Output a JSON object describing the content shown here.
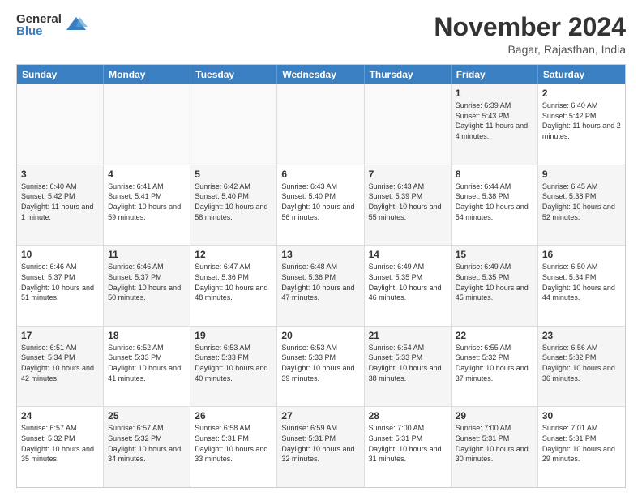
{
  "logo": {
    "general": "General",
    "blue": "Blue"
  },
  "header": {
    "month": "November 2024",
    "location": "Bagar, Rajasthan, India"
  },
  "weekdays": [
    "Sunday",
    "Monday",
    "Tuesday",
    "Wednesday",
    "Thursday",
    "Friday",
    "Saturday"
  ],
  "rows": [
    [
      {
        "day": "",
        "info": ""
      },
      {
        "day": "",
        "info": ""
      },
      {
        "day": "",
        "info": ""
      },
      {
        "day": "",
        "info": ""
      },
      {
        "day": "",
        "info": ""
      },
      {
        "day": "1",
        "info": "Sunrise: 6:39 AM\nSunset: 5:43 PM\nDaylight: 11 hours and 4 minutes."
      },
      {
        "day": "2",
        "info": "Sunrise: 6:40 AM\nSunset: 5:42 PM\nDaylight: 11 hours and 2 minutes."
      }
    ],
    [
      {
        "day": "3",
        "info": "Sunrise: 6:40 AM\nSunset: 5:42 PM\nDaylight: 11 hours and 1 minute."
      },
      {
        "day": "4",
        "info": "Sunrise: 6:41 AM\nSunset: 5:41 PM\nDaylight: 10 hours and 59 minutes."
      },
      {
        "day": "5",
        "info": "Sunrise: 6:42 AM\nSunset: 5:40 PM\nDaylight: 10 hours and 58 minutes."
      },
      {
        "day": "6",
        "info": "Sunrise: 6:43 AM\nSunset: 5:40 PM\nDaylight: 10 hours and 56 minutes."
      },
      {
        "day": "7",
        "info": "Sunrise: 6:43 AM\nSunset: 5:39 PM\nDaylight: 10 hours and 55 minutes."
      },
      {
        "day": "8",
        "info": "Sunrise: 6:44 AM\nSunset: 5:38 PM\nDaylight: 10 hours and 54 minutes."
      },
      {
        "day": "9",
        "info": "Sunrise: 6:45 AM\nSunset: 5:38 PM\nDaylight: 10 hours and 52 minutes."
      }
    ],
    [
      {
        "day": "10",
        "info": "Sunrise: 6:46 AM\nSunset: 5:37 PM\nDaylight: 10 hours and 51 minutes."
      },
      {
        "day": "11",
        "info": "Sunrise: 6:46 AM\nSunset: 5:37 PM\nDaylight: 10 hours and 50 minutes."
      },
      {
        "day": "12",
        "info": "Sunrise: 6:47 AM\nSunset: 5:36 PM\nDaylight: 10 hours and 48 minutes."
      },
      {
        "day": "13",
        "info": "Sunrise: 6:48 AM\nSunset: 5:36 PM\nDaylight: 10 hours and 47 minutes."
      },
      {
        "day": "14",
        "info": "Sunrise: 6:49 AM\nSunset: 5:35 PM\nDaylight: 10 hours and 46 minutes."
      },
      {
        "day": "15",
        "info": "Sunrise: 6:49 AM\nSunset: 5:35 PM\nDaylight: 10 hours and 45 minutes."
      },
      {
        "day": "16",
        "info": "Sunrise: 6:50 AM\nSunset: 5:34 PM\nDaylight: 10 hours and 44 minutes."
      }
    ],
    [
      {
        "day": "17",
        "info": "Sunrise: 6:51 AM\nSunset: 5:34 PM\nDaylight: 10 hours and 42 minutes."
      },
      {
        "day": "18",
        "info": "Sunrise: 6:52 AM\nSunset: 5:33 PM\nDaylight: 10 hours and 41 minutes."
      },
      {
        "day": "19",
        "info": "Sunrise: 6:53 AM\nSunset: 5:33 PM\nDaylight: 10 hours and 40 minutes."
      },
      {
        "day": "20",
        "info": "Sunrise: 6:53 AM\nSunset: 5:33 PM\nDaylight: 10 hours and 39 minutes."
      },
      {
        "day": "21",
        "info": "Sunrise: 6:54 AM\nSunset: 5:33 PM\nDaylight: 10 hours and 38 minutes."
      },
      {
        "day": "22",
        "info": "Sunrise: 6:55 AM\nSunset: 5:32 PM\nDaylight: 10 hours and 37 minutes."
      },
      {
        "day": "23",
        "info": "Sunrise: 6:56 AM\nSunset: 5:32 PM\nDaylight: 10 hours and 36 minutes."
      }
    ],
    [
      {
        "day": "24",
        "info": "Sunrise: 6:57 AM\nSunset: 5:32 PM\nDaylight: 10 hours and 35 minutes."
      },
      {
        "day": "25",
        "info": "Sunrise: 6:57 AM\nSunset: 5:32 PM\nDaylight: 10 hours and 34 minutes."
      },
      {
        "day": "26",
        "info": "Sunrise: 6:58 AM\nSunset: 5:31 PM\nDaylight: 10 hours and 33 minutes."
      },
      {
        "day": "27",
        "info": "Sunrise: 6:59 AM\nSunset: 5:31 PM\nDaylight: 10 hours and 32 minutes."
      },
      {
        "day": "28",
        "info": "Sunrise: 7:00 AM\nSunset: 5:31 PM\nDaylight: 10 hours and 31 minutes."
      },
      {
        "day": "29",
        "info": "Sunrise: 7:00 AM\nSunset: 5:31 PM\nDaylight: 10 hours and 30 minutes."
      },
      {
        "day": "30",
        "info": "Sunrise: 7:01 AM\nSunset: 5:31 PM\nDaylight: 10 hours and 29 minutes."
      }
    ]
  ]
}
